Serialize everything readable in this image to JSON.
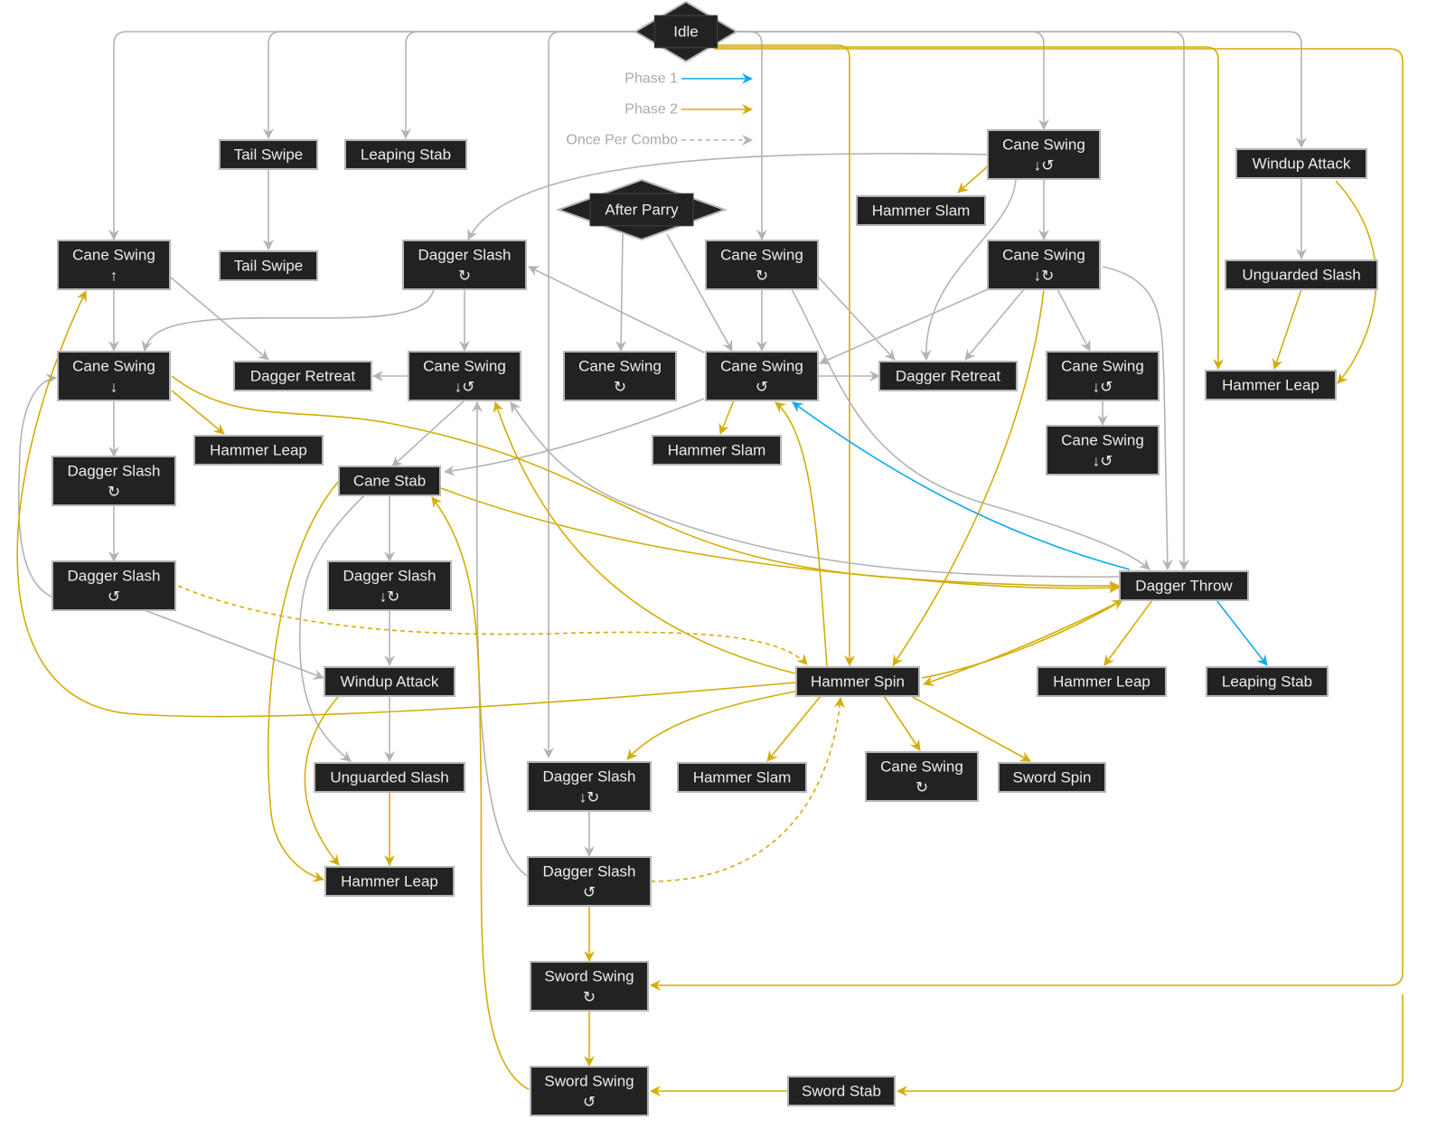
{
  "colors": {
    "default": "#b3b3b3",
    "phase1": "#13a9ee",
    "phase2": "#d4ad0a",
    "node_fill": "#222222",
    "node_border": "#b5b5b5"
  },
  "legend": [
    {
      "label": "Phase 1",
      "type": "phase1"
    },
    {
      "label": "Phase 2",
      "type": "phase2"
    },
    {
      "label": "Once Per Combo",
      "type": "dashed"
    }
  ],
  "nodes": [
    {
      "id": "idle",
      "label": "Idle",
      "shape": "diamond"
    },
    {
      "id": "after_parry",
      "label": "After Parry",
      "shape": "diamond"
    },
    {
      "id": "n1",
      "label": "Tail Swipe"
    },
    {
      "id": "n2",
      "label": "Leaping Stab"
    },
    {
      "id": "n3",
      "label": "Cane Swing",
      "sub": "↓↺"
    },
    {
      "id": "n4",
      "label": "Windup Attack"
    },
    {
      "id": "n5",
      "label": "Hammer Slam"
    },
    {
      "id": "n6",
      "label": "Cane Swing",
      "sub": "↑"
    },
    {
      "id": "n7",
      "label": "Tail Swipe"
    },
    {
      "id": "n8",
      "label": "Dagger Slash",
      "sub": "↻"
    },
    {
      "id": "n9",
      "label": "Cane Swing",
      "sub": "↻"
    },
    {
      "id": "n10",
      "label": "Cane Swing",
      "sub": "↓↻"
    },
    {
      "id": "n11",
      "label": "Unguarded Slash"
    },
    {
      "id": "n12",
      "label": "Cane Swing",
      "sub": "↓"
    },
    {
      "id": "n13",
      "label": "Dagger Retreat"
    },
    {
      "id": "n14",
      "label": "Cane Swing",
      "sub": "↓↺"
    },
    {
      "id": "n15",
      "label": "Cane Swing",
      "sub": "↻"
    },
    {
      "id": "n16",
      "label": "Cane Swing",
      "sub": "↺"
    },
    {
      "id": "n17",
      "label": "Dagger Retreat"
    },
    {
      "id": "n18",
      "label": "Cane Swing",
      "sub": "↓↺"
    },
    {
      "id": "n19",
      "label": "Hammer Leap"
    },
    {
      "id": "n20",
      "label": "Hammer Leap"
    },
    {
      "id": "n21",
      "label": "Hammer Slam"
    },
    {
      "id": "n22",
      "label": "Cane Swing",
      "sub": "↓↺"
    },
    {
      "id": "n23",
      "label": "Dagger Slash",
      "sub": "↻"
    },
    {
      "id": "n24",
      "label": "Cane Stab"
    },
    {
      "id": "n25",
      "label": "Dagger Slash",
      "sub": "↺"
    },
    {
      "id": "n26",
      "label": "Dagger Slash",
      "sub": "↓↻"
    },
    {
      "id": "n27",
      "label": "Dagger Throw"
    },
    {
      "id": "n28",
      "label": "Windup Attack"
    },
    {
      "id": "n29",
      "label": "Hammer Spin"
    },
    {
      "id": "n30",
      "label": "Hammer Leap"
    },
    {
      "id": "n31",
      "label": "Leaping Stab"
    },
    {
      "id": "n32",
      "label": "Unguarded Slash"
    },
    {
      "id": "n33",
      "label": "Dagger Slash",
      "sub": "↓↻"
    },
    {
      "id": "n34",
      "label": "Hammer Slam"
    },
    {
      "id": "n35",
      "label": "Cane Swing",
      "sub": "↻"
    },
    {
      "id": "n36",
      "label": "Sword Spin"
    },
    {
      "id": "n37",
      "label": "Hammer Leap"
    },
    {
      "id": "n38",
      "label": "Dagger Slash",
      "sub": "↺"
    },
    {
      "id": "n39",
      "label": "Sword Swing",
      "sub": "↻"
    },
    {
      "id": "n40",
      "label": "Sword Swing",
      "sub": "↺"
    },
    {
      "id": "n41",
      "label": "Sword Stab"
    }
  ],
  "edges": [
    {
      "from": "idle",
      "to": "n6",
      "type": "default"
    },
    {
      "from": "idle",
      "to": "n1",
      "type": "default"
    },
    {
      "from": "idle",
      "to": "n2",
      "type": "default"
    },
    {
      "from": "idle",
      "to": "n33",
      "type": "default"
    },
    {
      "from": "idle",
      "to": "n9",
      "type": "default"
    },
    {
      "from": "idle",
      "to": "n3",
      "type": "default"
    },
    {
      "from": "idle",
      "to": "n27",
      "type": "default"
    },
    {
      "from": "idle",
      "to": "n4",
      "type": "default"
    },
    {
      "from": "idle",
      "to": "n29",
      "type": "phase2"
    },
    {
      "from": "idle",
      "to": "n19",
      "type": "phase2"
    },
    {
      "from": "idle",
      "to": "n39",
      "type": "phase2"
    },
    {
      "from": "idle",
      "to": "n41",
      "type": "phase2"
    },
    {
      "from": "n1",
      "to": "n7",
      "type": "default"
    },
    {
      "from": "n3",
      "to": "n5",
      "type": "phase2"
    },
    {
      "from": "n3",
      "to": "n10",
      "type": "default"
    },
    {
      "from": "n3",
      "to": "n8",
      "type": "default"
    },
    {
      "from": "n3",
      "to": "n17",
      "type": "default"
    },
    {
      "from": "n4",
      "to": "n11",
      "type": "default"
    },
    {
      "from": "n4",
      "to": "n19",
      "type": "phase2"
    },
    {
      "from": "n11",
      "to": "n19",
      "type": "phase2"
    },
    {
      "from": "n6",
      "to": "n12",
      "type": "default"
    },
    {
      "from": "n6",
      "to": "n13",
      "type": "default"
    },
    {
      "from": "n8",
      "to": "n14",
      "type": "default"
    },
    {
      "from": "n8",
      "to": "n12",
      "type": "default"
    },
    {
      "from": "n9",
      "to": "n16",
      "type": "default"
    },
    {
      "from": "n9",
      "to": "n17",
      "type": "default"
    },
    {
      "from": "n9",
      "to": "n27",
      "type": "default"
    },
    {
      "from": "n10",
      "to": "n16",
      "type": "default"
    },
    {
      "from": "n10",
      "to": "n17",
      "type": "default"
    },
    {
      "from": "n10",
      "to": "n18",
      "type": "default"
    },
    {
      "from": "n10",
      "to": "n27",
      "type": "default"
    },
    {
      "from": "n10",
      "to": "n29",
      "type": "phase2"
    },
    {
      "from": "after_parry",
      "to": "n15",
      "type": "default"
    },
    {
      "from": "after_parry",
      "to": "n16",
      "type": "default"
    },
    {
      "from": "n16",
      "to": "n8",
      "type": "default"
    },
    {
      "from": "n16",
      "to": "n17",
      "type": "default"
    },
    {
      "from": "n16",
      "to": "n21",
      "type": "phase2"
    },
    {
      "from": "n16",
      "to": "n24",
      "type": "default"
    },
    {
      "from": "n14",
      "to": "n13",
      "type": "default"
    },
    {
      "from": "n14",
      "to": "n24",
      "type": "default"
    },
    {
      "from": "n18",
      "to": "n22",
      "type": "default"
    },
    {
      "from": "n12",
      "to": "n23",
      "type": "default"
    },
    {
      "from": "n12",
      "to": "n20",
      "type": "phase2"
    },
    {
      "from": "n12",
      "to": "n27",
      "type": "phase2"
    },
    {
      "from": "n23",
      "to": "n25",
      "type": "default"
    },
    {
      "from": "n25",
      "to": "n12",
      "type": "default"
    },
    {
      "from": "n25",
      "to": "n28",
      "type": "default"
    },
    {
      "from": "n25",
      "to": "n29",
      "type": "dashed-phase2"
    },
    {
      "from": "n24",
      "to": "n26",
      "type": "default"
    },
    {
      "from": "n24",
      "to": "n27",
      "type": "phase2"
    },
    {
      "from": "n24",
      "to": "n37",
      "type": "phase2"
    },
    {
      "from": "n24",
      "to": "n32",
      "type": "default"
    },
    {
      "from": "n26",
      "to": "n28",
      "type": "default"
    },
    {
      "from": "n28",
      "to": "n32",
      "type": "default"
    },
    {
      "from": "n28",
      "to": "n37",
      "type": "phase2"
    },
    {
      "from": "n32",
      "to": "n37",
      "type": "phase2"
    },
    {
      "from": "n27",
      "to": "n16",
      "type": "phase1"
    },
    {
      "from": "n27",
      "to": "n14",
      "type": "default"
    },
    {
      "from": "n27",
      "to": "n30",
      "type": "phase2"
    },
    {
      "from": "n27",
      "to": "n31",
      "type": "phase1"
    },
    {
      "from": "n27",
      "to": "n29",
      "type": "phase2"
    },
    {
      "from": "n29",
      "to": "n27",
      "type": "phase2"
    },
    {
      "from": "n29",
      "to": "n14",
      "type": "phase2"
    },
    {
      "from": "n29",
      "to": "n16",
      "type": "phase2"
    },
    {
      "from": "n29",
      "to": "n6",
      "type": "phase2"
    },
    {
      "from": "n29",
      "to": "n33",
      "type": "phase2"
    },
    {
      "from": "n29",
      "to": "n34",
      "type": "phase2"
    },
    {
      "from": "n29",
      "to": "n35",
      "type": "phase2"
    },
    {
      "from": "n29",
      "to": "n36",
      "type": "phase2"
    },
    {
      "from": "n33",
      "to": "n38",
      "type": "default"
    },
    {
      "from": "n38",
      "to": "n14",
      "type": "default"
    },
    {
      "from": "n38",
      "to": "n29",
      "type": "dashed-phase2"
    },
    {
      "from": "n38",
      "to": "n39",
      "type": "phase2"
    },
    {
      "from": "n39",
      "to": "n40",
      "type": "phase2"
    },
    {
      "from": "n40",
      "to": "n24",
      "type": "phase2"
    },
    {
      "from": "n41",
      "to": "n40",
      "type": "phase2"
    }
  ]
}
